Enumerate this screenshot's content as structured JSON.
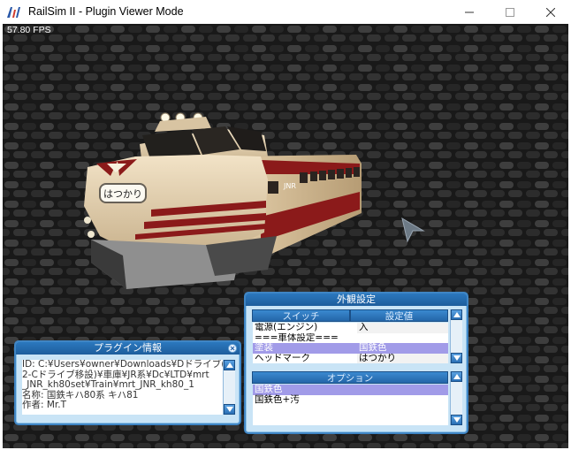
{
  "window": {
    "title": "RailSim II - Plugin Viewer Mode"
  },
  "viewport": {
    "fps": "57.80 FPS"
  },
  "train": {
    "headmark": "はつかり"
  },
  "appearance_panel": {
    "title": "外観設定",
    "headers": {
      "switch": "スイッチ",
      "value": "設定値",
      "option": "オプション"
    },
    "switches": [
      {
        "name": "電源(エンジン)",
        "value": "入"
      },
      {
        "name": "===車体設定===",
        "value": ""
      },
      {
        "name": "塗装",
        "value": "国鉄色",
        "selected": true
      },
      {
        "name": "ヘッドマーク",
        "value": "はつかり"
      }
    ],
    "options": [
      {
        "label": "国鉄色",
        "selected": true
      },
      {
        "label": "国鉄色+汚"
      }
    ]
  },
  "plugin_info_panel": {
    "title": "プラグイン情報",
    "lines": [
      "ID: C:¥Users¥owner¥Downloads¥Dドライブ(",
      "2-Cドライブ移設)¥車庫¥JR系¥Dc¥LTD¥mrt",
      "_JNR_kh80set¥Train¥mrt_JNR_kh80_1",
      "名称: 国鉄キハ80系 キハ81",
      "作者: Mr.T"
    ]
  }
}
